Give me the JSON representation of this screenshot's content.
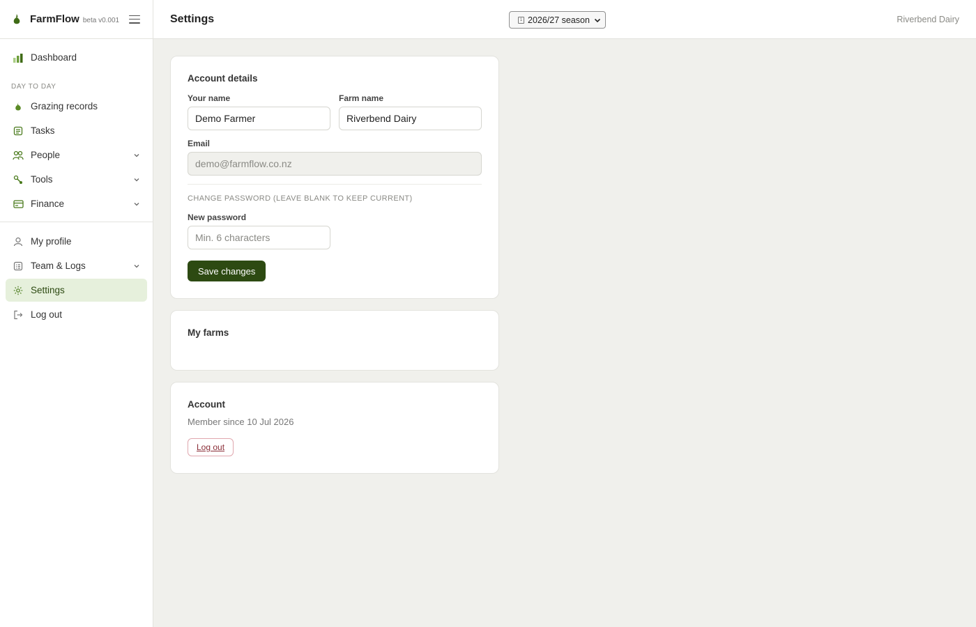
{
  "brand": {
    "name": "FarmFlow",
    "version": "beta v0.001"
  },
  "sidebar": {
    "top_items": [
      {
        "label": "Dashboard",
        "icon": "bar-chart-icon"
      }
    ],
    "section_label": "DAY TO DAY",
    "day_items": [
      {
        "label": "Grazing records",
        "icon": "grass-icon"
      },
      {
        "label": "Tasks",
        "icon": "clipboard-icon"
      },
      {
        "label": "People",
        "icon": "people-icon",
        "has_children": true
      },
      {
        "label": "Tools",
        "icon": "tools-icon",
        "has_children": true
      },
      {
        "label": "Finance",
        "icon": "card-icon",
        "has_children": true
      }
    ],
    "account_items": [
      {
        "label": "My profile",
        "icon": "user-icon"
      },
      {
        "label": "Team & Logs",
        "icon": "list-icon",
        "has_children": true
      },
      {
        "label": "Settings",
        "icon": "gear-icon",
        "active": true
      },
      {
        "label": "Log out",
        "icon": "logout-icon"
      }
    ]
  },
  "header": {
    "title": "Settings",
    "season_selected": "2026/27 season",
    "farm_name": "Riverbend Dairy"
  },
  "account_details": {
    "title": "Account details",
    "your_name_label": "Your name",
    "your_name_value": "Demo Farmer",
    "farm_name_label": "Farm name",
    "farm_name_value": "Riverbend Dairy",
    "email_label": "Email",
    "email_value": "demo@farmflow.co.nz",
    "password_section": "CHANGE PASSWORD (LEAVE BLANK TO KEEP CURRENT)",
    "new_password_label": "New password",
    "new_password_placeholder": "Min. 6 characters",
    "save_label": "Save changes"
  },
  "my_farms": {
    "title": "My farms"
  },
  "account": {
    "title": "Account",
    "member_since": "Member since 10 Jul 2026",
    "logout_label": "Log out"
  },
  "colors": {
    "accent": "#2d4a12",
    "active_bg": "#e6f0dc",
    "leaf": "#4a7a1c",
    "danger": "#8a2d37"
  }
}
